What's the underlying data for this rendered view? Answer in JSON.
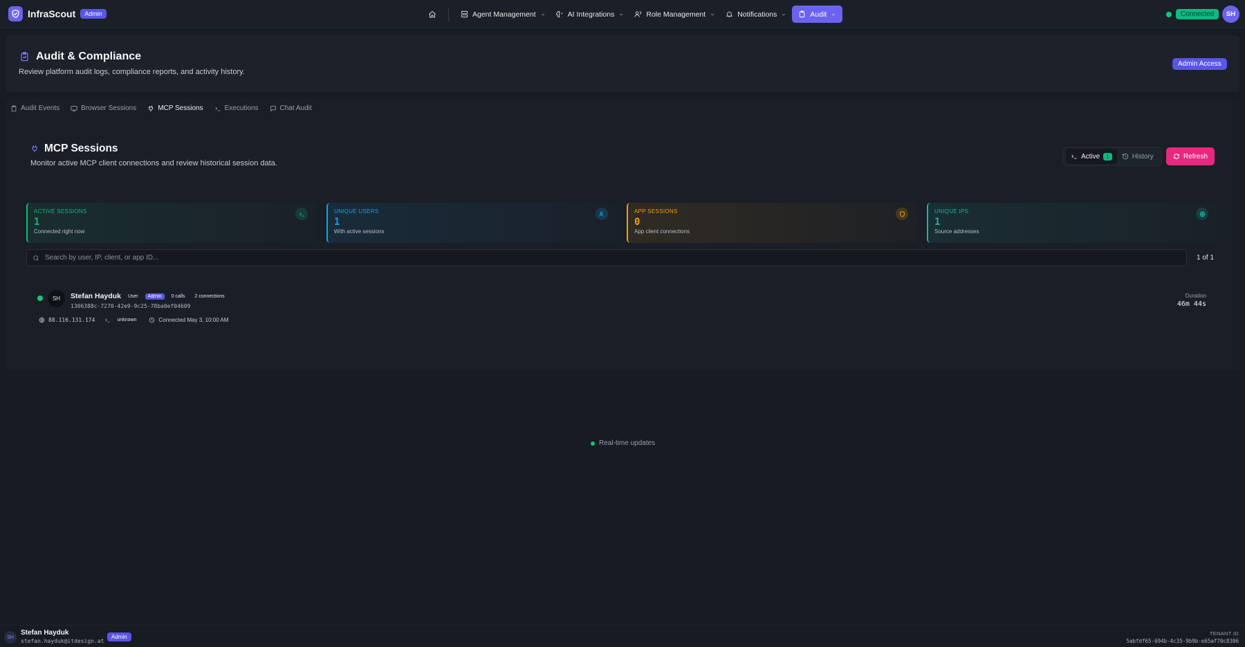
{
  "brand": {
    "name": "InfraScout",
    "badge": "Admin"
  },
  "nav": {
    "items": [
      {
        "label": "Agent Management",
        "icon": "server-icon"
      },
      {
        "label": "AI Integrations",
        "icon": "brain-icon"
      },
      {
        "label": "Role Management",
        "icon": "users-icon"
      },
      {
        "label": "Notifications",
        "icon": "bell-icon"
      },
      {
        "label": "Audit",
        "icon": "clipboard-icon",
        "active": true
      }
    ],
    "status": "Connected",
    "avatar": "SH"
  },
  "header": {
    "title": "Audit & Compliance",
    "subtitle": "Review platform audit logs, compliance reports, and activity history.",
    "access_badge": "Admin Access"
  },
  "tabs": [
    {
      "label": "Audit Events",
      "icon": "clipboard-icon"
    },
    {
      "label": "Browser Sessions",
      "icon": "monitor-icon"
    },
    {
      "label": "MCP Sessions",
      "icon": "plug-icon",
      "active": true
    },
    {
      "label": "Executions",
      "icon": "terminal-icon"
    },
    {
      "label": "Chat Audit",
      "icon": "message-icon"
    }
  ],
  "section": {
    "title": "MCP Sessions",
    "subtitle": "Monitor active MCP client connections and review historical session data.",
    "toggle": {
      "active_label": "Active",
      "active_count": "1",
      "history_label": "History"
    },
    "refresh_label": "Refresh"
  },
  "stats": [
    {
      "label": "ACTIVE SESSIONS",
      "value": "1",
      "desc": "Connected right now",
      "color": "#10b981",
      "icon": "terminal-icon"
    },
    {
      "label": "UNIQUE USERS",
      "value": "1",
      "desc": "With active sessions",
      "color": "#0ea5e9",
      "icon": "users-icon"
    },
    {
      "label": "APP SESSIONS",
      "value": "0",
      "desc": "App client connections",
      "color": "#f59e0b",
      "icon": "shield-icon"
    },
    {
      "label": "UNIQUE IPS",
      "value": "1",
      "desc": "Source addresses",
      "color": "#14b8a6",
      "icon": "globe-icon"
    }
  ],
  "search": {
    "placeholder": "Search by user, IP, client, or app ID...",
    "pager": "1 of 1"
  },
  "session": {
    "avatar": "SH",
    "name": "Stefan Hayduk",
    "role": "User",
    "badge": "Admin",
    "calls": "0 calls",
    "connections": "2 connections",
    "id": "1306388c-7270-42e9-9c25-78ba0ef04609",
    "ip": "88.116.131.174",
    "client": "unknown",
    "connected": "Connected May 3, 10:00 AM",
    "duration_label": "Duration",
    "duration": "46m 44s"
  },
  "realtime": "Real-time updates",
  "footer": {
    "avatar": "SH",
    "name": "Stefan Hayduk",
    "email": "stefan.hayduk@itdesign.at",
    "badge": "Admin",
    "tenant_label": "TENANT ID",
    "tenant_id": "5abfdf65-694b-4c35-9b9b-e65af70c8306"
  }
}
